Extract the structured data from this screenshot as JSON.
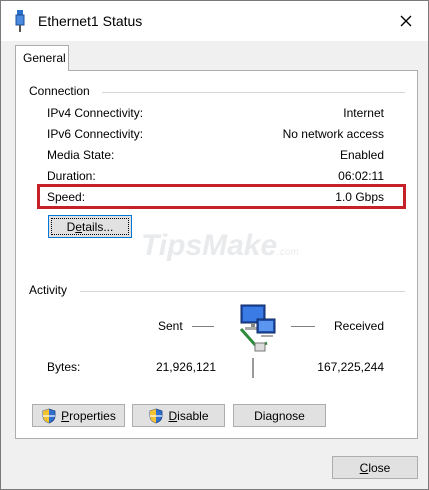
{
  "window": {
    "title": "Ethernet1 Status"
  },
  "tabs": [
    {
      "label": "General"
    }
  ],
  "connection": {
    "heading": "Connection",
    "rows": [
      {
        "label": "IPv4 Connectivity:",
        "value": "Internet"
      },
      {
        "label": "IPv6 Connectivity:",
        "value": "No network access"
      },
      {
        "label": "Media State:",
        "value": "Enabled"
      },
      {
        "label": "Duration:",
        "value": "06:02:11"
      },
      {
        "label": "Speed:",
        "value": "1.0 Gbps"
      }
    ],
    "details_button": {
      "pre": "D",
      "accel": "e",
      "post": "tails..."
    }
  },
  "watermark": {
    "text": "TipsMake",
    "suffix": ".com"
  },
  "activity": {
    "heading": "Activity",
    "sent_label": "Sent",
    "received_label": "Received",
    "bytes_label": "Bytes:",
    "bytes_sent": "21,926,121",
    "bytes_received": "167,225,244"
  },
  "buttons": {
    "properties": {
      "accel": "P",
      "post": "roperties"
    },
    "disable": {
      "accel": "D",
      "post": "isable"
    },
    "diagnose": {
      "label": "Diagnose"
    },
    "close": {
      "accel": "C",
      "post": "lose"
    }
  },
  "colors": {
    "highlight": "#c42128",
    "focus": "#0078d7"
  },
  "icons": [
    "ethernet-cable-icon",
    "close-icon",
    "shield-icon",
    "network-computers-icon"
  ]
}
